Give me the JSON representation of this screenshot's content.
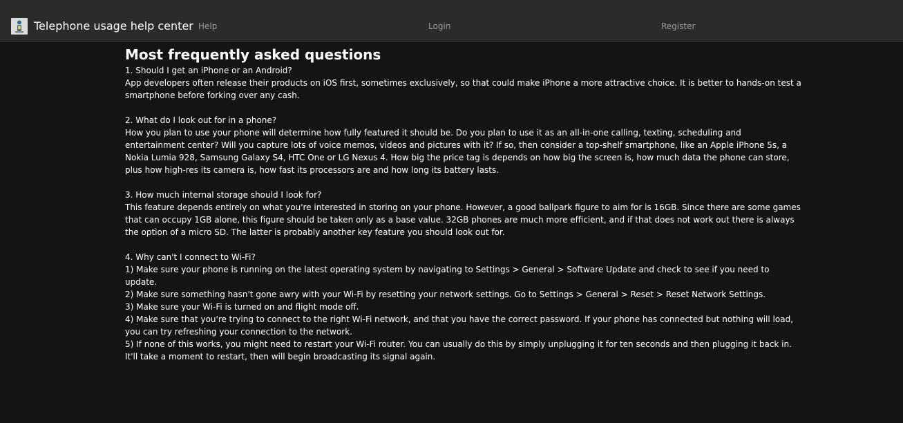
{
  "navbar": {
    "brand": "Telephone usage help center",
    "logo_icon": "phone-help-icon",
    "links": {
      "help": "Help",
      "login": "Login",
      "register": "Register"
    }
  },
  "main": {
    "title": "Most frequently asked questions",
    "faqs": [
      {
        "question": "1. Should I get an iPhone or an Android?",
        "answer_lines": [
          "App developers often release their products on iOS first, sometimes exclusively, so that could make iPhone a more attractive choice. It is better to hands-on test a smartphone before forking over any cash."
        ]
      },
      {
        "question": "2. What do I look out for in a phone?",
        "answer_lines": [
          "How you plan to use your phone will determine how fully featured it should be. Do you plan to use it as an all-in-one calling, texting, scheduling and entertainment center? Will you capture lots of voice memos, videos and pictures with it? If so, then consider a top-shelf smartphone, like an Apple iPhone 5s, a Nokia Lumia 928, Samsung Galaxy S4, HTC One or LG Nexus 4. How big the price tag is depends on how big the screen is, how much data the phone can store, plus how high-res its camera is, how fast its processors are and how long its battery lasts."
        ]
      },
      {
        "question": "3. How much internal storage should I look for?",
        "answer_lines": [
          "This feature depends entirely on what you're interested in storing on your phone. However, a good ballpark figure to aim for is 16GB. Since there are some games that can occupy 1GB alone, this figure should be taken only as a base value. 32GB phones are much more efficient, and if that does not work out there is always the option of a micro SD. The latter is probably another key feature you should look out for."
        ]
      },
      {
        "question": "4. Why can't I connect to Wi-Fi?",
        "answer_lines": [
          "1) Make sure your phone is running on the latest operating system by navigating to Settings > General > Software Update and check to see if you need to update.",
          "2) Make sure something hasn't gone awry with your Wi-Fi by resetting your network settings. Go to Settings > General > Reset > Reset Network Settings.",
          "3) Make sure your Wi-Fi is turned on and flight mode off.",
          "4) Make sure that you're trying to connect to the right Wi-Fi network, and that you have the correct password. If your phone has connected but nothing will load, you can try refreshing your connection to the network.",
          "5) If none of this works, you might need to restart your Wi-Fi router. You can usually do this by simply unplugging it for ten seconds and then plugging it back in. It'll take a moment to restart, then will begin broadcasting its signal again."
        ]
      }
    ]
  }
}
